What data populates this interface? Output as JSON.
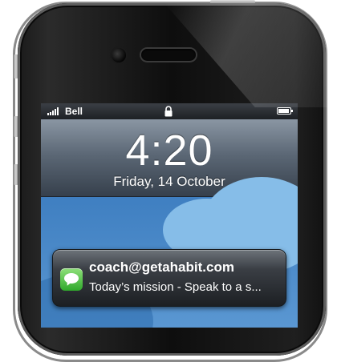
{
  "status_bar": {
    "carrier": "Bell",
    "signal_bars": 5,
    "battery_level": 0.9
  },
  "lock_screen": {
    "time": "4:20",
    "date": "Friday, 14 October"
  },
  "notification": {
    "app_icon": "messages-icon",
    "sender": "coach@getahabit.com",
    "message": "Today’s mission - Speak to a s..."
  },
  "colors": {
    "wallpaper": "#4a86c3",
    "message_icon": "#2fa82b"
  }
}
